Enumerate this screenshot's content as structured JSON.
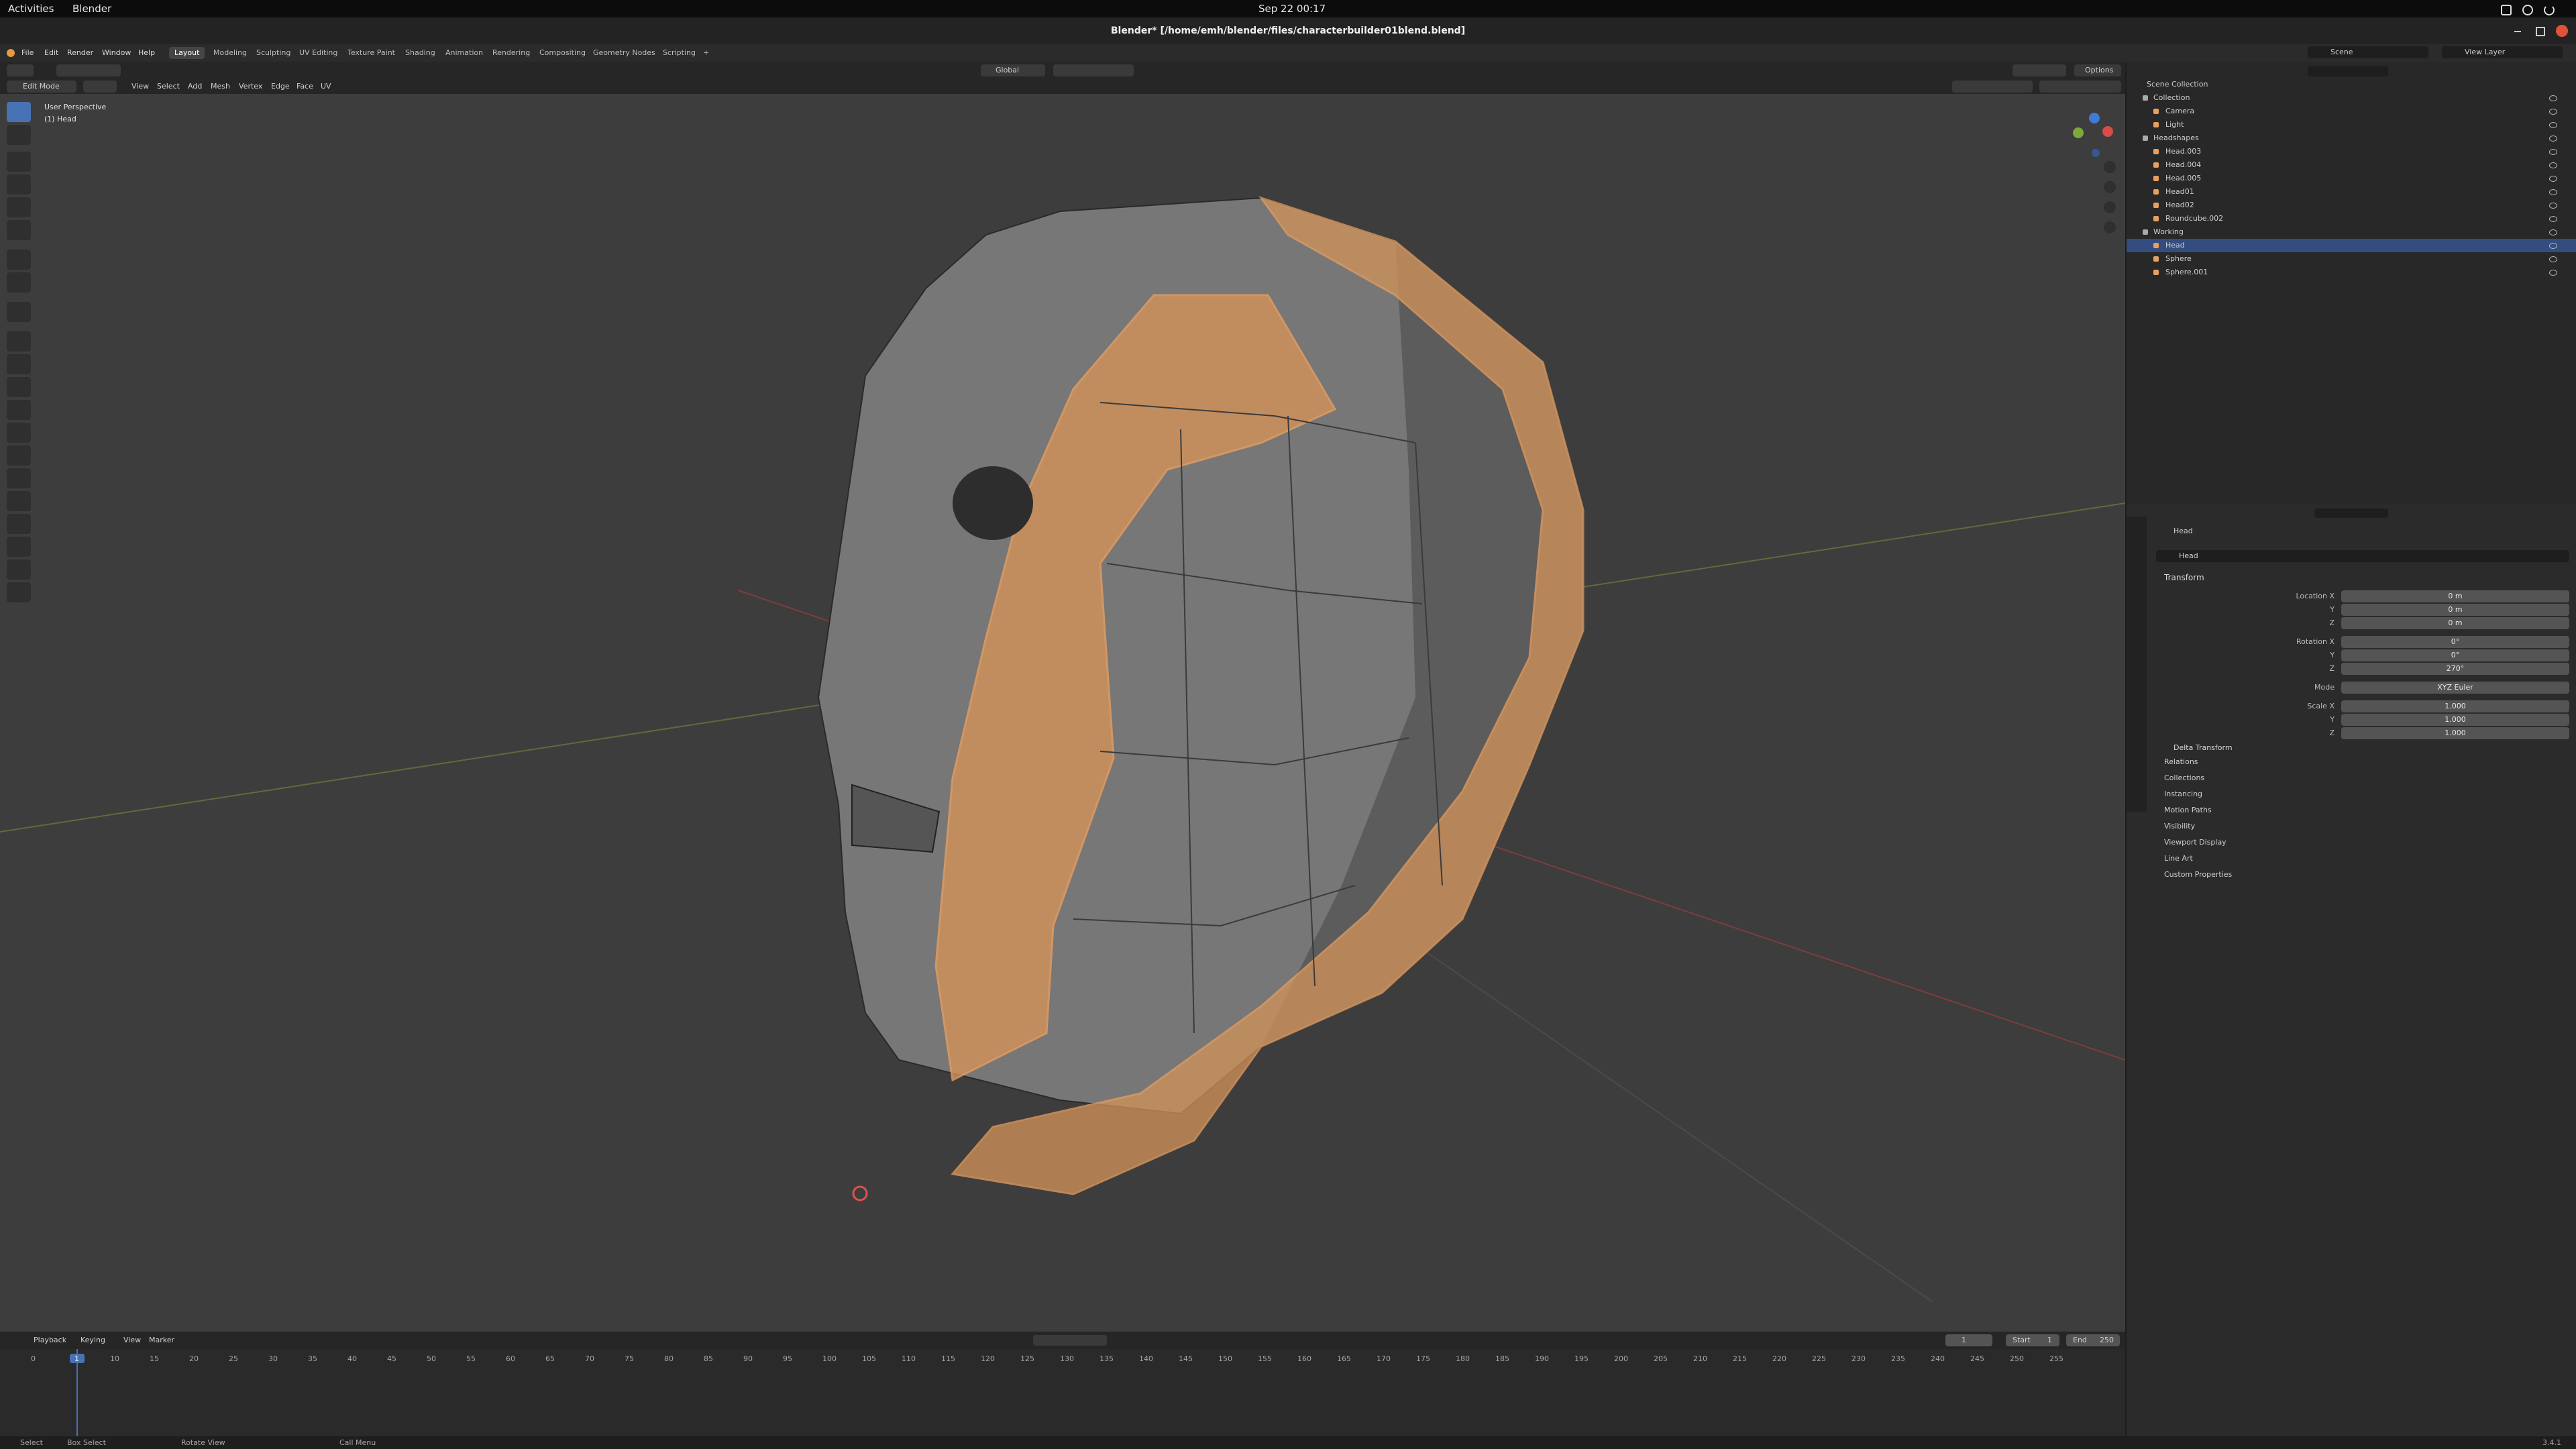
{
  "system": {
    "activities": "Activities",
    "app_menu": "Blender",
    "clock": "Sep 22  00:17"
  },
  "window": {
    "title": "Blender* [/home/emh/blender/files/characterbuilder01blend.blend]"
  },
  "menu": [
    "File",
    "Edit",
    "Render",
    "Window",
    "Help"
  ],
  "workspaces": [
    "Layout",
    "Modeling",
    "Sculpting",
    "UV Editing",
    "Texture Paint",
    "Shading",
    "Animation",
    "Rendering",
    "Compositing",
    "Geometry Nodes",
    "Scripting"
  ],
  "workspace_add": "+",
  "active_workspace": "Layout",
  "scene": {
    "name": "Scene",
    "view_layer": "View Layer"
  },
  "viewport_header": {
    "mode": "Edit Mode",
    "menus": [
      "View",
      "Select",
      "Add",
      "Mesh",
      "Vertex",
      "Edge",
      "Face",
      "UV"
    ],
    "orientation": "Global",
    "options": "Options"
  },
  "viewport": {
    "perspective": "User Perspective",
    "object": "(1) Head"
  },
  "outliner": {
    "root": "Scene Collection",
    "items": [
      {
        "name": "Collection",
        "level": 1
      },
      {
        "name": "Camera",
        "level": 2
      },
      {
        "name": "Light",
        "level": 2
      },
      {
        "name": "Headshapes",
        "level": 1
      },
      {
        "name": "Head.003",
        "level": 2
      },
      {
        "name": "Head.004",
        "level": 2
      },
      {
        "name": "Head.005",
        "level": 2
      },
      {
        "name": "Head01",
        "level": 2
      },
      {
        "name": "Head02",
        "level": 2
      },
      {
        "name": "Roundcube.002",
        "level": 2
      },
      {
        "name": "Working",
        "level": 1
      },
      {
        "name": "Head",
        "level": 2
      },
      {
        "name": "Sphere",
        "level": 2
      },
      {
        "name": "Sphere.001",
        "level": 2
      }
    ]
  },
  "properties": {
    "object_name": "Head",
    "data_name": "Head",
    "transform_title": "Transform",
    "location": {
      "labels": [
        "Location X",
        "Y",
        "Z"
      ],
      "values": [
        "0 m",
        "0 m",
        "0 m"
      ]
    },
    "rotation": {
      "labels": [
        "Rotation X",
        "Y",
        "Z"
      ],
      "values": [
        "0°",
        "0°",
        "270°"
      ]
    },
    "mode_label": "Mode",
    "mode_value": "XYZ Euler",
    "scale": {
      "labels": [
        "Scale X",
        "Y",
        "Z"
      ],
      "values": [
        "1.000",
        "1.000",
        "1.000"
      ]
    },
    "delta": "Delta Transform",
    "panels": [
      "Relations",
      "Collections",
      "Instancing",
      "Motion Paths",
      "Visibility",
      "Viewport Display",
      "Line Art",
      "Custom Properties"
    ]
  },
  "timeline": {
    "menus": [
      "Playback",
      "Keying",
      "View",
      "Marker"
    ],
    "current_frame": "1",
    "start_label": "Start",
    "start": "1",
    "end_label": "End",
    "end": "250",
    "ticks": [
      "0",
      "5",
      "10",
      "15",
      "20",
      "25",
      "30",
      "35",
      "40",
      "45",
      "50",
      "55",
      "60",
      "65",
      "70",
      "75",
      "80",
      "85",
      "90",
      "95",
      "100",
      "105",
      "110",
      "115",
      "120",
      "125",
      "130",
      "135",
      "140",
      "145",
      "150",
      "155",
      "160",
      "165",
      "170",
      "175",
      "180",
      "185",
      "190",
      "195",
      "200",
      "205",
      "210",
      "215",
      "220",
      "225",
      "230",
      "235",
      "240",
      "245",
      "250",
      "255"
    ]
  },
  "status_bar": [
    "Select",
    "Box Select",
    "Rotate View",
    "Call Menu"
  ],
  "version": "3.4.1",
  "colors": {
    "accent": "#4772b3",
    "selected_face": "#d4935a",
    "background": "#3d3d3d"
  }
}
